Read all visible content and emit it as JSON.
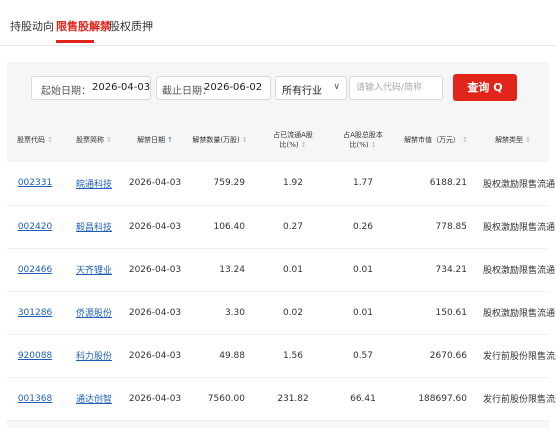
{
  "tabs": [
    {
      "label": "持股动向"
    },
    {
      "label": "限售股解禁",
      "active": true
    },
    {
      "label": "股权质押"
    }
  ],
  "filters": {
    "start_label": "起始日期：",
    "start_value": "2026-04-03",
    "end_label": "截止日期：",
    "end_value": "2026-06-02",
    "industry_value": "所有行业",
    "search_placeholder": "请输入代码/简称",
    "query_label": "查询 Q"
  },
  "colors": {
    "accent": "#e1251b",
    "link": "#1e5fb8",
    "header_bg": "#f5f6f8"
  },
  "table": {
    "headers": [
      {
        "l1": "股票代码",
        "l2": "",
        "sort": "none"
      },
      {
        "l1": "股票简称",
        "l2": "",
        "sort": "none"
      },
      {
        "l1": "解禁日期",
        "l2": "",
        "sort": "active"
      },
      {
        "l1": "解禁数量(万股)",
        "l2": "",
        "sort": "none"
      },
      {
        "l1": "占已流通A股",
        "l2": "比(%)",
        "sort": "none"
      },
      {
        "l1": "占A股总股本",
        "l2": "比(%)",
        "sort": "none"
      },
      {
        "l1": "解禁市值（万元）",
        "l2": "",
        "sort": "none"
      },
      {
        "l1": "解禁类型",
        "l2": "",
        "sort": "none"
      }
    ],
    "rows": [
      {
        "code": "002331",
        "name": "皖通科技",
        "date": "2026-04-03",
        "qty": "759.29",
        "pct_float": "1.92",
        "pct_total": "1.77",
        "value": "6188.21",
        "type": "股权激励限售流通"
      },
      {
        "code": "002420",
        "name": "毅昌科技",
        "date": "2026-04-03",
        "qty": "106.40",
        "pct_float": "0.27",
        "pct_total": "0.26",
        "value": "778.85",
        "type": "股权激励限售流通"
      },
      {
        "code": "002466",
        "name": "天齐锂业",
        "date": "2026-04-03",
        "qty": "13.24",
        "pct_float": "0.01",
        "pct_total": "0.01",
        "value": "734.21",
        "type": "股权激励限售流通"
      },
      {
        "code": "301286",
        "name": "侨源股份",
        "date": "2026-04-03",
        "qty": "3.30",
        "pct_float": "0.02",
        "pct_total": "0.01",
        "value": "150.61",
        "type": "股权激励限售流通"
      },
      {
        "code": "920088",
        "name": "科力股份",
        "date": "2026-04-03",
        "qty": "49.88",
        "pct_float": "1.56",
        "pct_total": "0.57",
        "value": "2670.66",
        "type": "发行前股份限售流通"
      },
      {
        "code": "001368",
        "name": "通达创智",
        "date": "2026-04-03",
        "qty": "7560.00",
        "pct_float": "231.82",
        "pct_total": "66.41",
        "value": "188697.60",
        "type": "发行前股份限售流通"
      }
    ]
  }
}
